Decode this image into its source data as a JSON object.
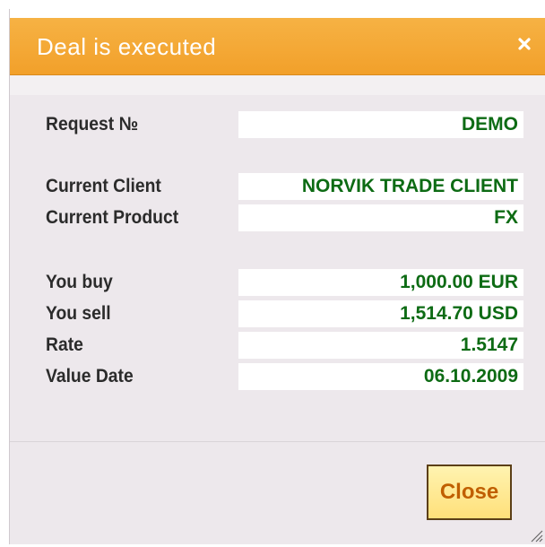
{
  "dialog": {
    "title": "Deal is executed",
    "close_icon": "close-icon"
  },
  "fields": {
    "request_no": {
      "label": "Request №",
      "value": "DEMO"
    },
    "current_client": {
      "label": "Current Client",
      "value": "NORVIK TRADE CLIENT"
    },
    "current_product": {
      "label": "Current Product",
      "value": "FX"
    },
    "you_buy": {
      "label": "You buy",
      "value": "1,000.00 EUR"
    },
    "you_sell": {
      "label": "You sell",
      "value": "1,514.70 USD"
    },
    "rate": {
      "label": "Rate",
      "value": "1.5147"
    },
    "value_date": {
      "label": "Value Date",
      "value": "06.10.2009"
    }
  },
  "footer": {
    "close_label": "Close"
  },
  "colors": {
    "titlebar": "#f2a02a",
    "value_text": "#0d6b14",
    "close_text": "#c05f00"
  }
}
